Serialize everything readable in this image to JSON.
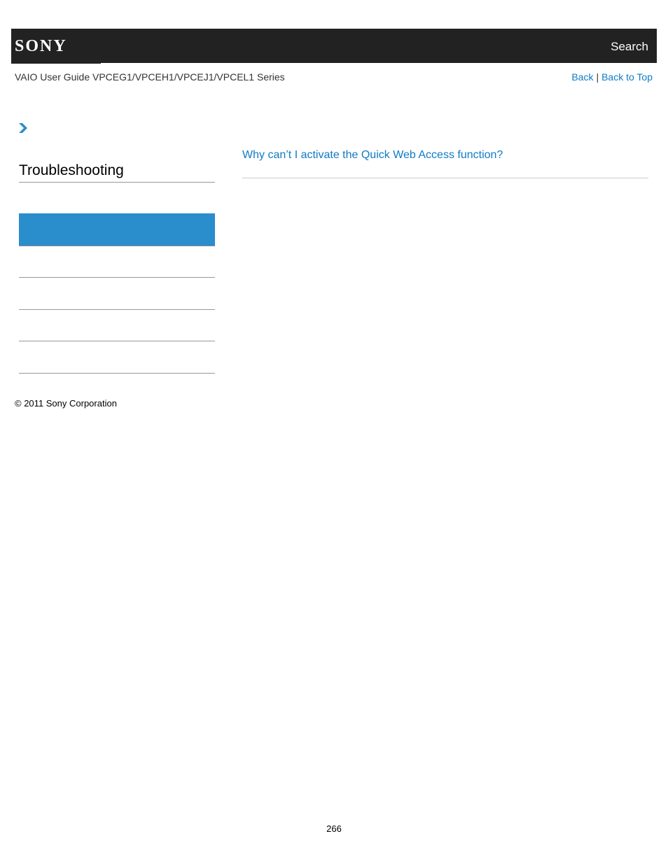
{
  "header": {
    "logo_text": "SONY",
    "search_label": "Search"
  },
  "guide": {
    "title": "VAIO User Guide VPCEG1/VPCEH1/VPCEJ1/VPCEL1 Series"
  },
  "topnav": {
    "back_label": "Back",
    "separator": "|",
    "back_to_top_label": "Back to Top"
  },
  "breadcrumb": {
    "icon": "chevron-right-icon"
  },
  "sidebar": {
    "section_title": "Troubleshooting",
    "items": [
      {
        "label": "",
        "active": true
      },
      {
        "label": "",
        "active": false
      },
      {
        "label": "",
        "active": false
      },
      {
        "label": "",
        "active": false
      },
      {
        "label": "",
        "active": false
      }
    ]
  },
  "main": {
    "questions": [
      {
        "label": "Why can’t I activate the Quick Web Access function?"
      }
    ]
  },
  "footer": {
    "copyright": "© 2011 Sony Corporation",
    "page_number": "266"
  },
  "colors": {
    "header_bg": "#222222",
    "link": "#0f7bc4",
    "active_nav": "#2a8dcc"
  }
}
